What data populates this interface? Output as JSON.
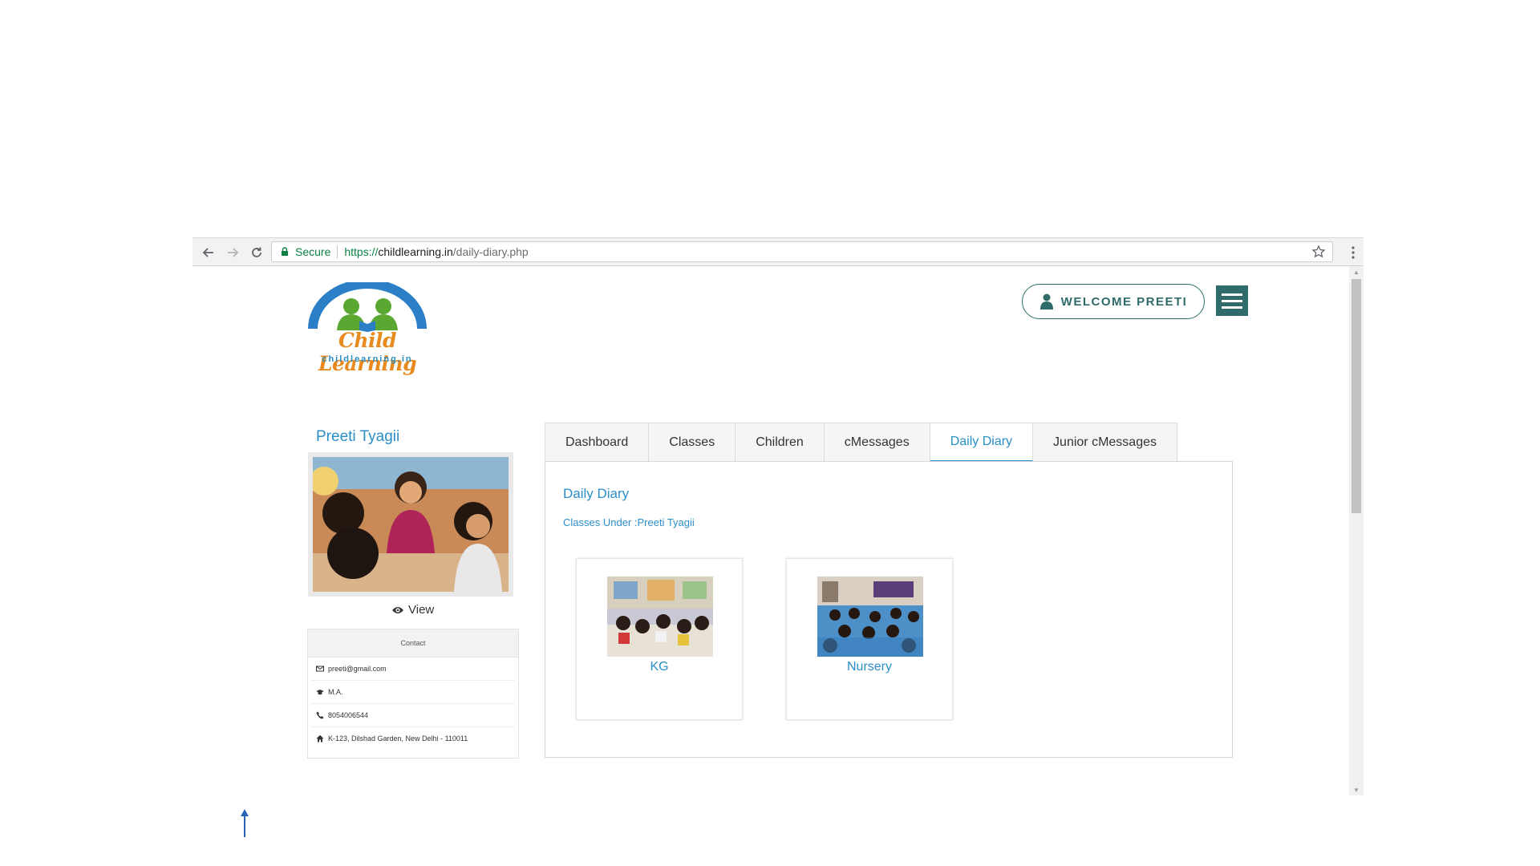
{
  "browser": {
    "secure_label": "Secure",
    "url_scheme": "https://",
    "url_host": "childlearning.in",
    "url_path": "/daily-diary.php"
  },
  "brand": {
    "name": "Child Learning",
    "domain": "childlearning.in",
    "colors": {
      "primary": "#2e6b6a",
      "accent": "#2a8ec7",
      "logo_orange": "#e88a1e"
    }
  },
  "header": {
    "welcome_label": "WELCOME PREETI",
    "menu_icon": "hamburger-icon"
  },
  "profile": {
    "name": "Preeti Tyagii",
    "view_label": "View",
    "contact_title": "Contact",
    "contacts": [
      {
        "icon": "envelope-icon",
        "text": "preeti@gmail.com"
      },
      {
        "icon": "graduation-cap-icon",
        "text": "M.A."
      },
      {
        "icon": "phone-icon",
        "text": "8054006544"
      },
      {
        "icon": "home-icon",
        "text": "K-123, Dilshad Garden, New Delhi - 110011"
      }
    ]
  },
  "tabs": [
    {
      "label": "Dashboard",
      "active": false
    },
    {
      "label": "Classes",
      "active": false
    },
    {
      "label": "Children",
      "active": false
    },
    {
      "label": "cMessages",
      "active": false
    },
    {
      "label": "Daily Diary",
      "active": true
    },
    {
      "label": "Junior cMessages",
      "active": false
    }
  ],
  "panel": {
    "title": "Daily Diary",
    "subtitle": "Classes Under :Preeti Tyagii",
    "classes": [
      {
        "label": "KG"
      },
      {
        "label": "Nursery"
      }
    ]
  }
}
